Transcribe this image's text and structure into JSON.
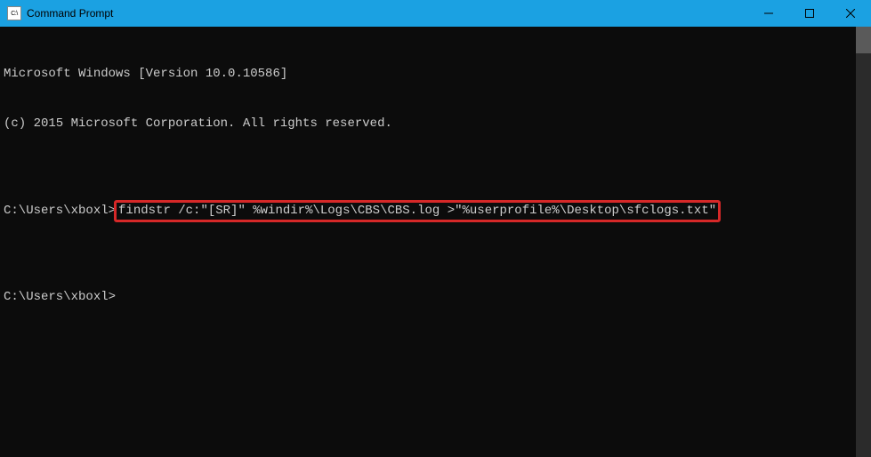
{
  "window": {
    "title": "Command Prompt"
  },
  "terminal": {
    "line1": "Microsoft Windows [Version 10.0.10586]",
    "line2": "(c) 2015 Microsoft Corporation. All rights reserved.",
    "blank": "",
    "prompt1": "C:\\Users\\xboxl>",
    "command1": "findstr /c:\"[SR]\" %windir%\\Logs\\CBS\\CBS.log >\"%userprofile%\\Desktop\\sfclogs.txt\"",
    "prompt2": "C:\\Users\\xboxl>"
  },
  "icons": {
    "cmd": "C:\\"
  }
}
